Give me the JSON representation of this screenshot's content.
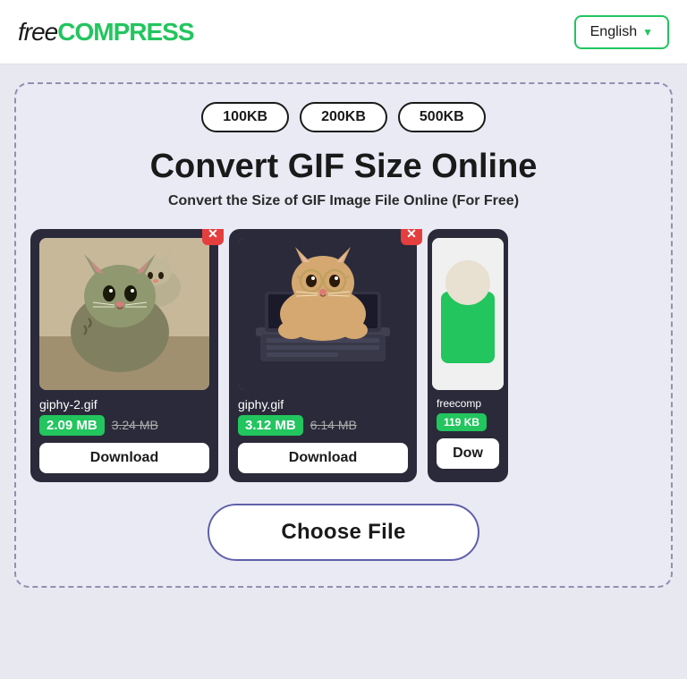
{
  "header": {
    "logo_free": "free",
    "logo_compress": "COMPRESS",
    "lang_button": "English",
    "lang_chevron": "▼"
  },
  "size_presets": [
    {
      "label": "100KB",
      "id": "100kb"
    },
    {
      "label": "200KB",
      "id": "200kb"
    },
    {
      "label": "500KB",
      "id": "500kb"
    }
  ],
  "main": {
    "title": "Convert GIF Size Online",
    "subtitle": "Convert the Size of GIF Image File Online (For Free)",
    "choose_file": "Choose File"
  },
  "cards": [
    {
      "filename": "giphy-2.gif",
      "size_new": "2.09 MB",
      "size_old": "3.24 MB",
      "download": "Download",
      "type": "cat1"
    },
    {
      "filename": "giphy.gif",
      "size_new": "3.12 MB",
      "size_old": "6.14 MB",
      "download": "Download",
      "type": "cat2"
    },
    {
      "filename": "freecomp",
      "size_new": "119 KB",
      "size_old": "",
      "download": "Dow",
      "type": "cat3"
    }
  ]
}
